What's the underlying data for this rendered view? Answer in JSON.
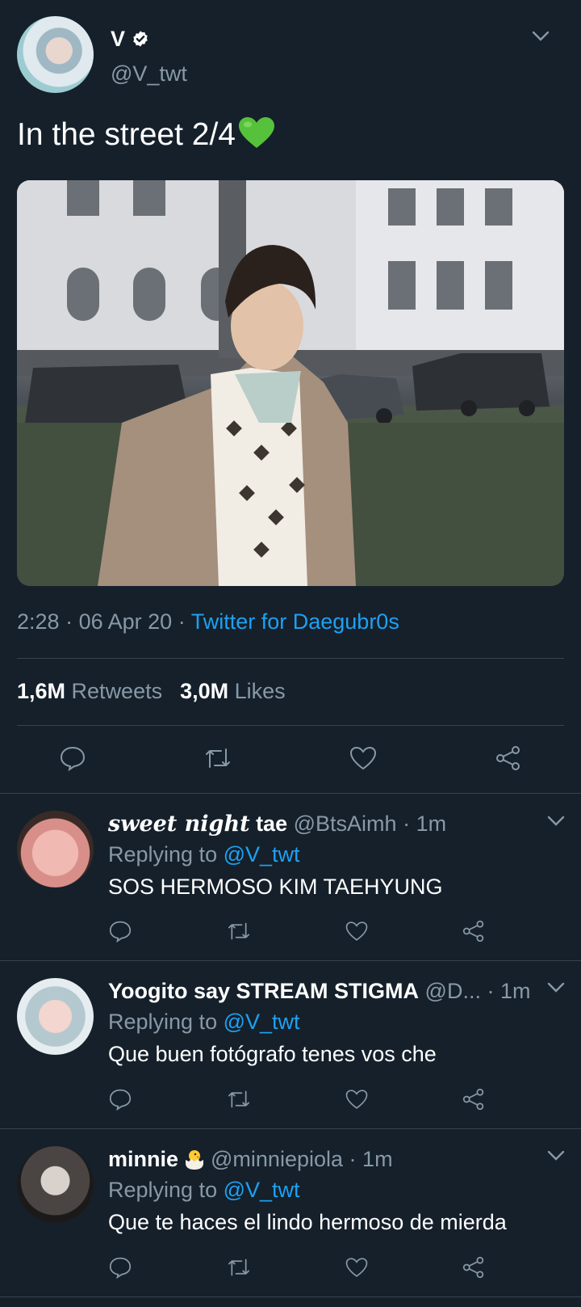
{
  "main_tweet": {
    "author_name": "V",
    "handle": "@V_twt",
    "text": "In the street 2/4",
    "emoji": "green-heart",
    "time": "2:28",
    "date": "06 Apr 20",
    "source": "Twitter for Daegubr0s",
    "retweets_count": "1,6M",
    "retweets_label": "Retweets",
    "likes_count": "3,0M",
    "likes_label": "Likes"
  },
  "replies": [
    {
      "name_italic": "sweet night",
      "name": "tae",
      "handle": "@BtsAimh",
      "time": "1m",
      "replying_label": "Replying to",
      "mention": "@V_twt",
      "text": "SOS HERMOSO KIM TAEHYUNG"
    },
    {
      "name": "Yoogito say STREAM STIGMA",
      "handle": "@D...",
      "time": "1m",
      "replying_label": "Replying to",
      "mention": "@V_twt",
      "text": "Que buen fotógrafo tenes vos che"
    },
    {
      "name": "minnie",
      "emoji": "hatching-chick",
      "handle": "@minniepiola",
      "time": "1m",
      "replying_label": "Replying to",
      "mention": "@V_twt",
      "text": "Que te haces el lindo hermoso de mierda"
    }
  ],
  "separator": "·",
  "colors": {
    "background": "#15202b",
    "text_primary": "#ffffff",
    "text_secondary": "#8899a6",
    "accent": "#1da1f2",
    "divider": "#38444d"
  },
  "icons": [
    "chevron-down-icon",
    "verified-badge-icon",
    "reply-icon",
    "retweet-icon",
    "like-icon",
    "share-icon"
  ]
}
